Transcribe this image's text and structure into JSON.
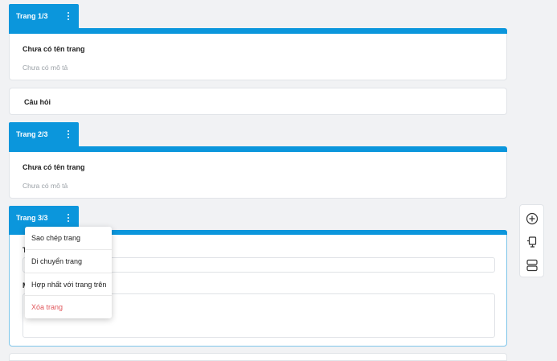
{
  "pages": [
    {
      "tab_label": "Trang 1/3",
      "title": "Chưa có tên trang",
      "description": "Chưa có mô tả"
    },
    {
      "tab_label": "Trang 2/3",
      "title": "Chưa có tên trang",
      "description": "Chưa có mô tả"
    },
    {
      "tab_label": "Trang 3/3",
      "field1_label": "T",
      "field2_label": "M"
    }
  ],
  "question": {
    "label": "Câu hỏi"
  },
  "page_menu": {
    "items": [
      "Sao chép trang",
      "Di chuyển trang",
      "Hợp nhất với trang trên",
      "Xóa trang"
    ]
  },
  "side_toolbar": {
    "icons": [
      "add-circle-icon",
      "import-title-icon",
      "add-section-icon"
    ]
  },
  "colors": {
    "accent": "#0b96dc",
    "danger": "#e0565b",
    "muted": "#9aa0a6",
    "background": "#f1f2f4"
  }
}
